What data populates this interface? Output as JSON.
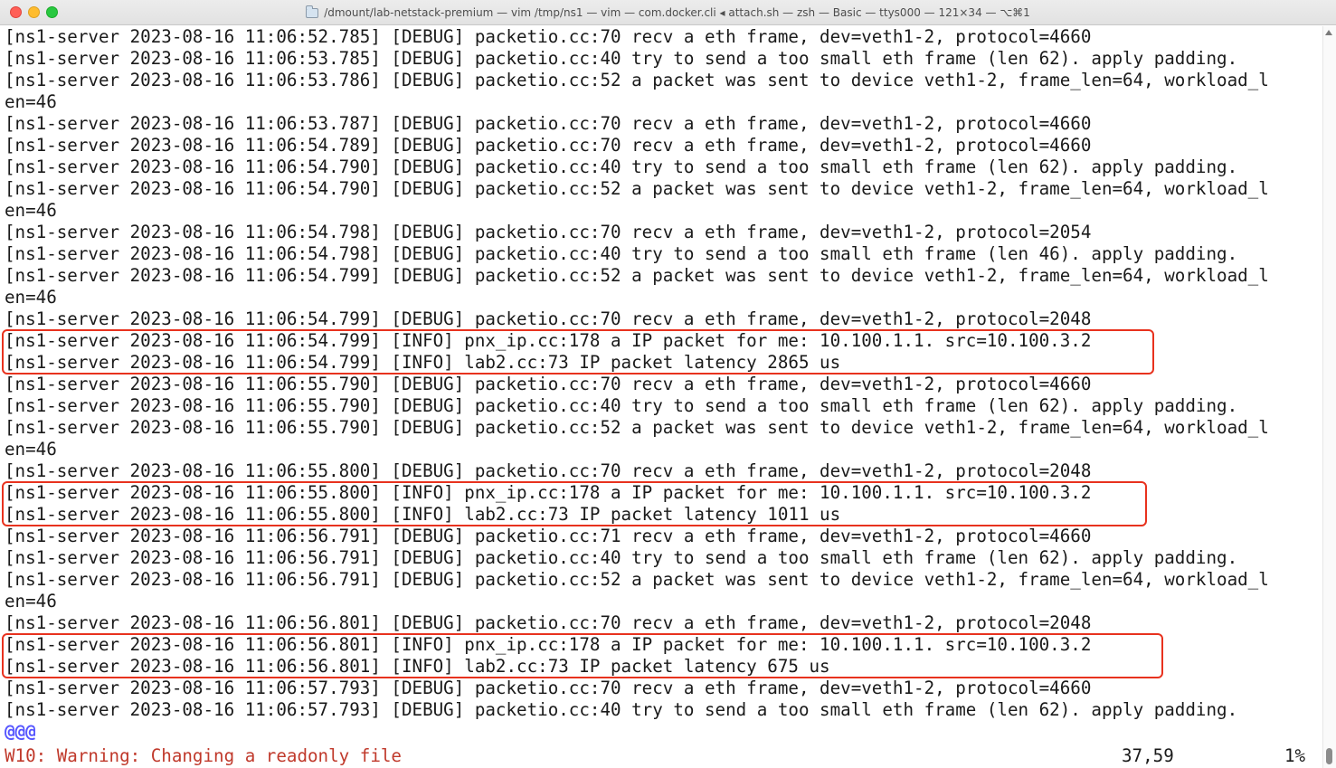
{
  "window": {
    "title": "/dmount/lab-netstack-premium — vim /tmp/ns1 — vim — com.docker.cli ◂ attach.sh — zsh — Basic — ttys000 — 121×34 — ⌥⌘1"
  },
  "terminal": {
    "lines": [
      "[ns1-server 2023-08-16 11:06:52.785] [DEBUG] packetio.cc:70 recv a eth frame, dev=veth1-2, protocol=4660",
      "[ns1-server 2023-08-16 11:06:53.785] [DEBUG] packetio.cc:40 try to send a too small eth frame (len 62). apply padding.",
      "[ns1-server 2023-08-16 11:06:53.786] [DEBUG] packetio.cc:52 a packet was sent to device veth1-2, frame_len=64, workload_l",
      "en=46",
      "[ns1-server 2023-08-16 11:06:53.787] [DEBUG] packetio.cc:70 recv a eth frame, dev=veth1-2, protocol=4660",
      "[ns1-server 2023-08-16 11:06:54.789] [DEBUG] packetio.cc:70 recv a eth frame, dev=veth1-2, protocol=4660",
      "[ns1-server 2023-08-16 11:06:54.790] [DEBUG] packetio.cc:40 try to send a too small eth frame (len 62). apply padding.",
      "[ns1-server 2023-08-16 11:06:54.790] [DEBUG] packetio.cc:52 a packet was sent to device veth1-2, frame_len=64, workload_l",
      "en=46",
      "[ns1-server 2023-08-16 11:06:54.798] [DEBUG] packetio.cc:70 recv a eth frame, dev=veth1-2, protocol=2054",
      "[ns1-server 2023-08-16 11:06:54.798] [DEBUG] packetio.cc:40 try to send a too small eth frame (len 46). apply padding.",
      "[ns1-server 2023-08-16 11:06:54.799] [DEBUG] packetio.cc:52 a packet was sent to device veth1-2, frame_len=64, workload_l",
      "en=46",
      "[ns1-server 2023-08-16 11:06:54.799] [DEBUG] packetio.cc:70 recv a eth frame, dev=veth1-2, protocol=2048",
      "[ns1-server 2023-08-16 11:06:54.799] [INFO] pnx_ip.cc:178 a IP packet for me: 10.100.1.1. src=10.100.3.2",
      "[ns1-server 2023-08-16 11:06:54.799] [INFO] lab2.cc:73 IP packet latency 2865 us",
      "[ns1-server 2023-08-16 11:06:55.790] [DEBUG] packetio.cc:70 recv a eth frame, dev=veth1-2, protocol=4660",
      "[ns1-server 2023-08-16 11:06:55.790] [DEBUG] packetio.cc:40 try to send a too small eth frame (len 62). apply padding.",
      "[ns1-server 2023-08-16 11:06:55.790] [DEBUG] packetio.cc:52 a packet was sent to device veth1-2, frame_len=64, workload_l",
      "en=46",
      "[ns1-server 2023-08-16 11:06:55.800] [DEBUG] packetio.cc:70 recv a eth frame, dev=veth1-2, protocol=2048",
      "[ns1-server 2023-08-16 11:06:55.800] [INFO] pnx_ip.cc:178 a IP packet for me: 10.100.1.1. src=10.100.3.2",
      "[ns1-server 2023-08-16 11:06:55.800] [INFO] lab2.cc:73 IP packet latency 1011 us",
      "[ns1-server 2023-08-16 11:06:56.791] [DEBUG] packetio.cc:71 recv a eth frame, dev=veth1-2, protocol=4660",
      "[ns1-server 2023-08-16 11:06:56.791] [DEBUG] packetio.cc:40 try to send a too small eth frame (len 62). apply padding.",
      "[ns1-server 2023-08-16 11:06:56.791] [DEBUG] packetio.cc:52 a packet was sent to device veth1-2, frame_len=64, workload_l",
      "en=46",
      "[ns1-server 2023-08-16 11:06:56.801] [DEBUG] packetio.cc:70 recv a eth frame, dev=veth1-2, protocol=2048",
      "[ns1-server 2023-08-16 11:06:56.801] [INFO] pnx_ip.cc:178 a IP packet for me: 10.100.1.1. src=10.100.3.2",
      "[ns1-server 2023-08-16 11:06:56.801] [INFO] lab2.cc:73 IP packet latency 675 us",
      "[ns1-server 2023-08-16 11:06:57.793] [DEBUG] packetio.cc:70 recv a eth frame, dev=veth1-2, protocol=4660",
      "[ns1-server 2023-08-16 11:06:57.793] [DEBUG] packetio.cc:40 try to send a too small eth frame (len 62). apply padding.",
      "@@@"
    ],
    "highlighted_line_indexes": [
      [
        14,
        15
      ],
      [
        21,
        22
      ],
      [
        28,
        29
      ]
    ]
  },
  "statusline": {
    "message": "W10: Warning: Changing a readonly file",
    "position": "37,59",
    "percent": "1%"
  },
  "colors": {
    "highlight_border": "#e8321e",
    "warning_text": "#c0392b",
    "tilde_marker": "#5555ff"
  }
}
